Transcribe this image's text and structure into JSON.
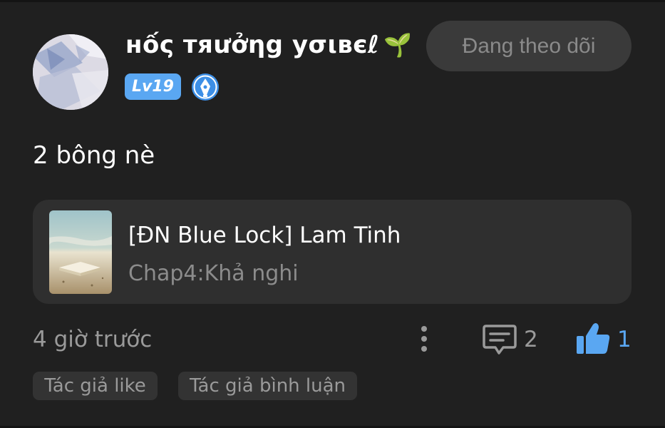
{
  "user": {
    "name": "нốς тяưởηg уσιвєℓ",
    "emoji": "🌱",
    "level": "Lv19",
    "follow_label": "Đang theo dõi"
  },
  "post": {
    "text": "2 bông nè",
    "time": "4 giờ trước",
    "comment_count": "2",
    "like_count": "1"
  },
  "story": {
    "title": "[ĐN Blue Lock] Lam Tinh",
    "chapter": "Chap4:Khả nghi"
  },
  "tags": [
    "Tác giả like",
    "Tác giả bình luận"
  ],
  "colors": {
    "background": "#202020",
    "card": "#2f2f2f",
    "accent": "#5aa7f2",
    "muted_text": "#9a9a9a"
  },
  "icons": {
    "more": "vertical-dots-icon",
    "comment": "comment-icon",
    "like": "thumbs-up-icon",
    "badge": "pen-nib-badge-icon"
  }
}
